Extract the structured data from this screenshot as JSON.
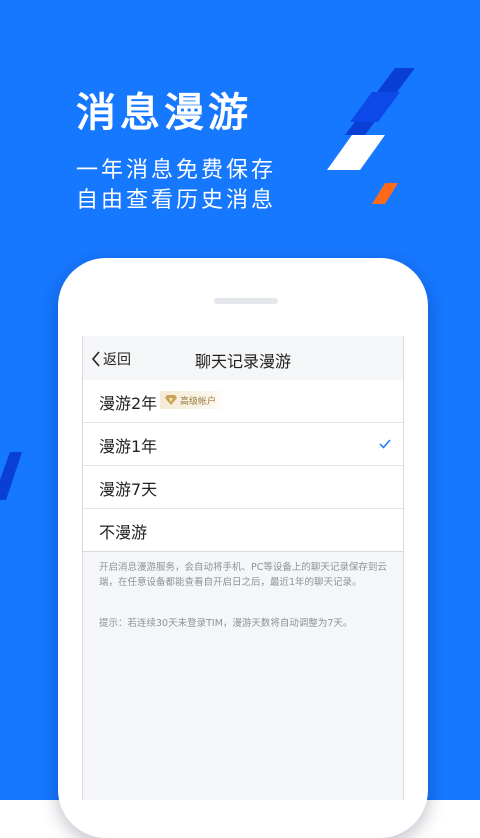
{
  "colors": {
    "brand": "#1677ff",
    "accent_orange": "#ff6a1a",
    "check": "#1677ff"
  },
  "hero": {
    "title": "消息漫游",
    "subtitle_line1": "一年消息免费保存",
    "subtitle_line2": "自由查看历史消息"
  },
  "navbar": {
    "back_label": "返回",
    "title": "聊天记录漫游"
  },
  "options": [
    {
      "label": "漫游2年",
      "badge": "高级帐户",
      "selected": false
    },
    {
      "label": "漫游1年",
      "selected": true
    },
    {
      "label": "漫游7天",
      "selected": false
    },
    {
      "label": "不漫游",
      "selected": false
    }
  ],
  "description": "开启消息漫游服务，会自动将手机、PC等设备上的聊天记录保存到云端，在任意设备都能查看自开启日之后，最近1年的聊天记录。",
  "tip": "提示：若连续30天未登录TIM，漫游天数将自动调整为7天。"
}
